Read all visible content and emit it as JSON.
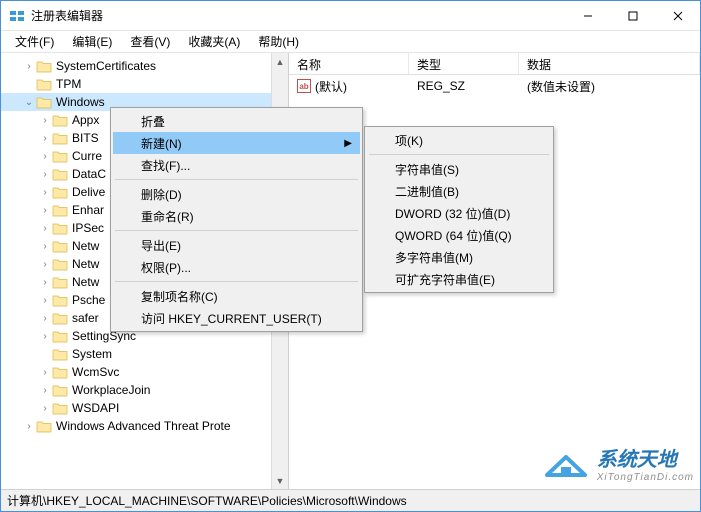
{
  "window": {
    "title": "注册表编辑器"
  },
  "menubar": {
    "file": "文件(F)",
    "edit": "编辑(E)",
    "view": "查看(V)",
    "favorites": "收藏夹(A)",
    "help": "帮助(H)"
  },
  "tree": {
    "items": [
      {
        "depth": 1,
        "twisty": ">",
        "label": "SystemCertificates"
      },
      {
        "depth": 1,
        "twisty": " ",
        "label": "TPM"
      },
      {
        "depth": 1,
        "twisty": "v",
        "label": "Windows",
        "selected": true
      },
      {
        "depth": 2,
        "twisty": ">",
        "label": "Appx"
      },
      {
        "depth": 2,
        "twisty": ">",
        "label": "BITS"
      },
      {
        "depth": 2,
        "twisty": ">",
        "label": "Curre"
      },
      {
        "depth": 2,
        "twisty": ">",
        "label": "DataC"
      },
      {
        "depth": 2,
        "twisty": ">",
        "label": "Delive"
      },
      {
        "depth": 2,
        "twisty": ">",
        "label": "Enhar"
      },
      {
        "depth": 2,
        "twisty": ">",
        "label": "IPSec"
      },
      {
        "depth": 2,
        "twisty": ">",
        "label": "Netw"
      },
      {
        "depth": 2,
        "twisty": ">",
        "label": "Netw"
      },
      {
        "depth": 2,
        "twisty": ">",
        "label": "Netw"
      },
      {
        "depth": 2,
        "twisty": ">",
        "label": "Psche"
      },
      {
        "depth": 2,
        "twisty": ">",
        "label": "safer"
      },
      {
        "depth": 2,
        "twisty": ">",
        "label": "SettingSync"
      },
      {
        "depth": 2,
        "twisty": " ",
        "label": "System"
      },
      {
        "depth": 2,
        "twisty": ">",
        "label": "WcmSvc"
      },
      {
        "depth": 2,
        "twisty": ">",
        "label": "WorkplaceJoin"
      },
      {
        "depth": 2,
        "twisty": ">",
        "label": "WSDAPI"
      },
      {
        "depth": 1,
        "twisty": ">",
        "label": "Windows Advanced Threat Prote"
      }
    ]
  },
  "list": {
    "headers": {
      "name": "名称",
      "type": "类型",
      "data": "数据"
    },
    "rows": [
      {
        "name": "(默认)",
        "type": "REG_SZ",
        "data": "(数值未设置)"
      }
    ]
  },
  "context_menu_1": {
    "collapse": "折叠",
    "new": "新建(N)",
    "find": "查找(F)...",
    "delete": "删除(D)",
    "rename": "重命名(R)",
    "export": "导出(E)",
    "permissions": "权限(P)...",
    "copy_key_name": "复制项名称(C)",
    "goto_hkcu": "访问 HKEY_CURRENT_USER(T)"
  },
  "context_menu_2": {
    "key": "项(K)",
    "string": "字符串值(S)",
    "binary": "二进制值(B)",
    "dword": "DWORD (32 位)值(D)",
    "qword": "QWORD (64 位)值(Q)",
    "multi_string": "多字符串值(M)",
    "expand_string": "可扩充字符串值(E)"
  },
  "statusbar": {
    "path": "计算机\\HKEY_LOCAL_MACHINE\\SOFTWARE\\Policies\\Microsoft\\Windows"
  },
  "watermark": {
    "text": "系统天地",
    "sub": "XiTongTianDi.com"
  }
}
